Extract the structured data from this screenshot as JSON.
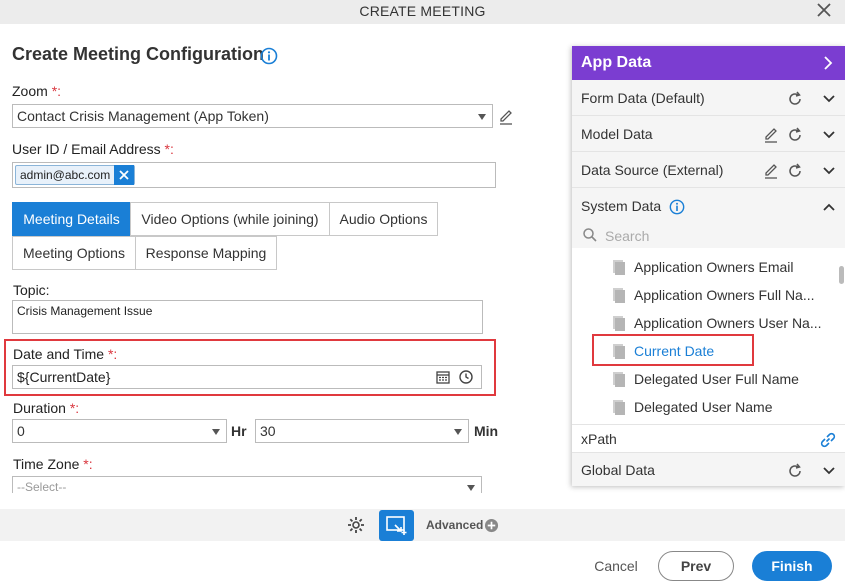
{
  "dialog": {
    "title": "CREATE MEETING"
  },
  "page": {
    "title": "Create Meeting Configuration"
  },
  "form": {
    "zoom": {
      "label": "Zoom",
      "required": "*:",
      "value": "Contact Crisis Management (App Token)"
    },
    "user_id": {
      "label": "User ID / Email Address",
      "required": "*:",
      "chip": "admin@abc.com"
    },
    "tabs": [
      {
        "label": "Meeting Details"
      },
      {
        "label": "Video Options (while joining)"
      },
      {
        "label": "Audio Options"
      },
      {
        "label": "Meeting Options"
      },
      {
        "label": "Response Mapping"
      }
    ],
    "topic": {
      "label": "Topic:",
      "value": "Crisis Management Issue"
    },
    "date_time": {
      "label": "Date and Time",
      "required": "*:",
      "value": "${CurrentDate}"
    },
    "duration": {
      "label": "Duration",
      "required": "*:",
      "hours": "0",
      "hr_unit": "Hr",
      "minutes": "30",
      "min_unit": "Min"
    },
    "time_zone": {
      "label": "Time Zone",
      "required": "*:",
      "placeholder": "--Select--"
    }
  },
  "app_data": {
    "title": "App Data",
    "sections": [
      {
        "label": "Form Data (Default)"
      },
      {
        "label": "Model Data"
      },
      {
        "label": "Data Source (External)"
      },
      {
        "label": "System Data"
      }
    ],
    "search_placeholder": "Search",
    "items": [
      {
        "label": "Application Owners Email"
      },
      {
        "label": "Application Owners Full Na..."
      },
      {
        "label": "Application Owners User Na..."
      },
      {
        "label": "Current Date"
      },
      {
        "label": "Delegated User Full Name"
      },
      {
        "label": "Delegated User Name"
      }
    ],
    "xpath_label": "xPath",
    "global_label": "Global Data"
  },
  "toolbar": {
    "advanced_label": "Advanced"
  },
  "footer": {
    "cancel": "Cancel",
    "prev": "Prev",
    "finish": "Finish"
  },
  "colors": {
    "accent": "#1a7fd6",
    "panel_header": "#7b3dd1",
    "highlight": "#e0393e"
  }
}
